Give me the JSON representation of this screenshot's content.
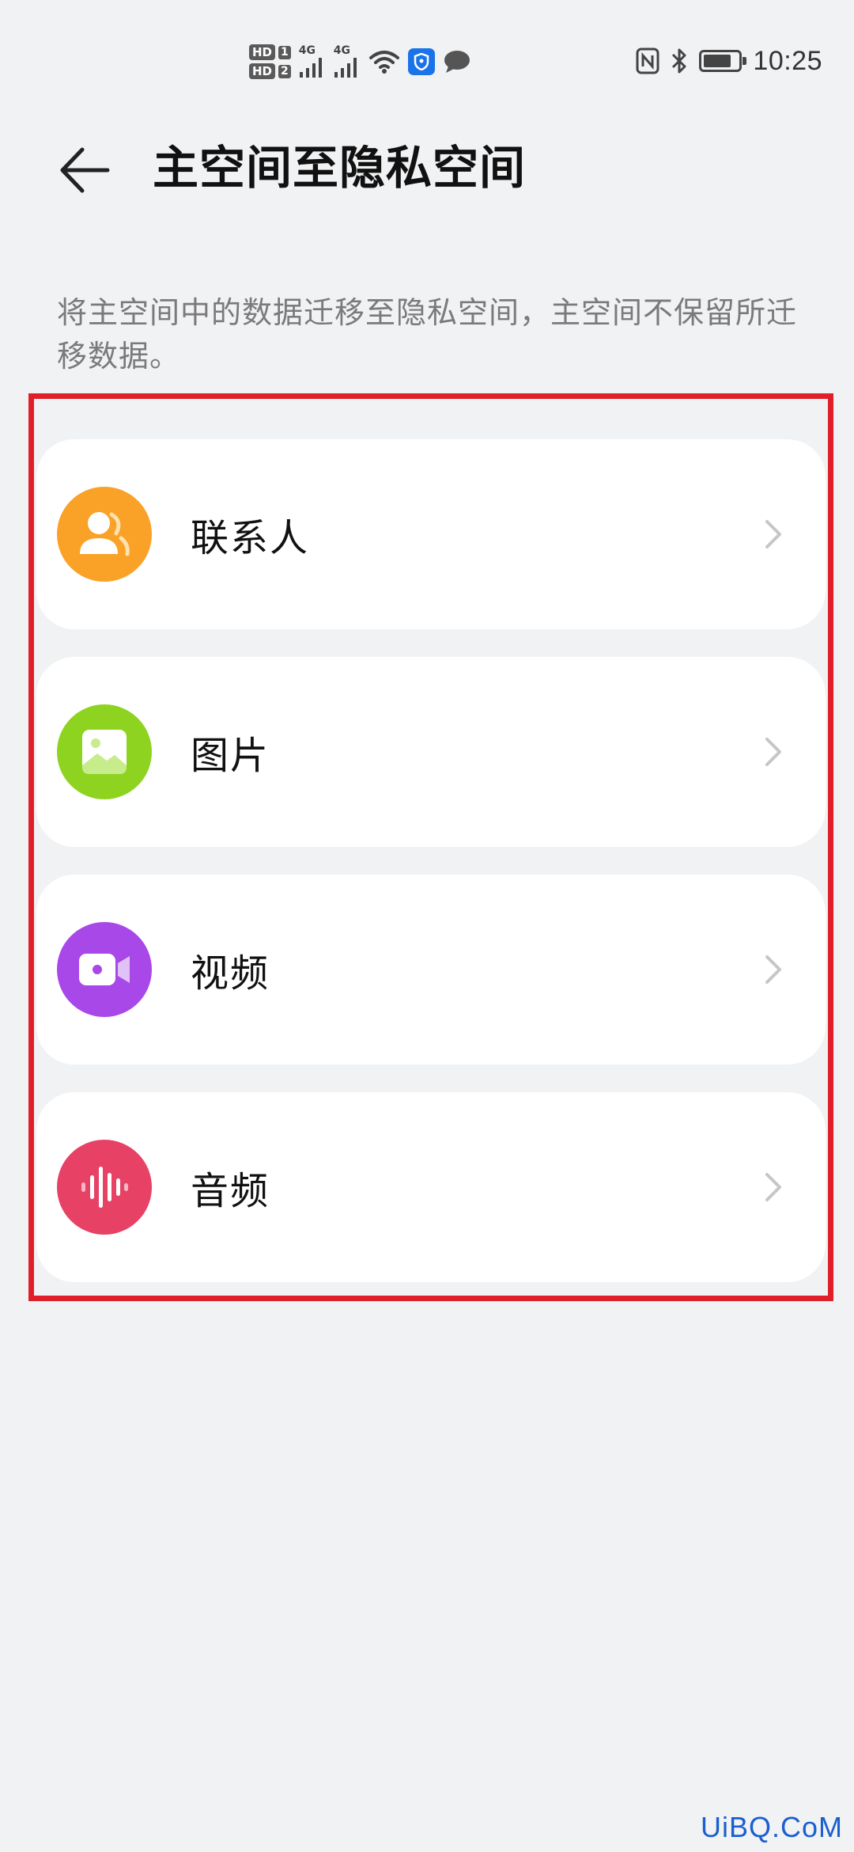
{
  "status_bar": {
    "hd1": "HD",
    "hd1_num": "1",
    "hd2": "HD",
    "hd2_num": "2",
    "net1": "4G",
    "net2": "4G",
    "time": "10:25",
    "battery_level": 0.8,
    "icons": [
      "signal-icon",
      "wifi-icon",
      "shield-icon",
      "message-icon",
      "nfc-icon",
      "bluetooth-icon",
      "battery-icon"
    ]
  },
  "header": {
    "title": "主空间至隐私空间"
  },
  "description": "将主空间中的数据迁移至隐私空间，主空间不保留所迁移数据。",
  "items": [
    {
      "label": "联系人",
      "icon": "contacts-icon",
      "color": "#f9a227"
    },
    {
      "label": "图片",
      "icon": "image-icon",
      "color": "#8fd321"
    },
    {
      "label": "视频",
      "icon": "video-icon",
      "color": "#a848e8"
    },
    {
      "label": "音频",
      "icon": "audio-icon",
      "color": "#e84166"
    }
  ],
  "highlight_color": "#e01f2a",
  "watermark": "UiBQ.CoM"
}
